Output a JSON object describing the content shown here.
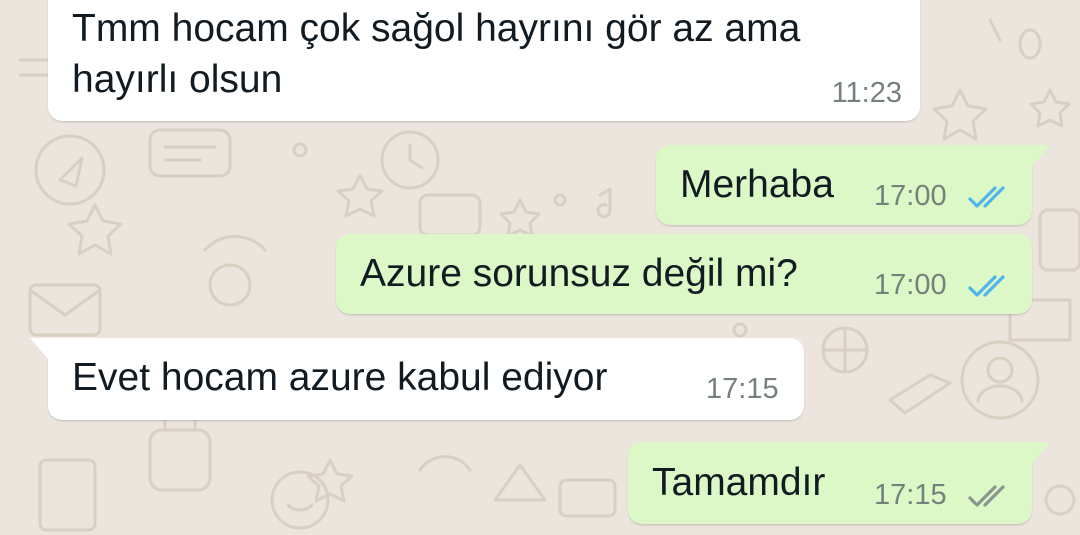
{
  "chat": {
    "messages": [
      {
        "direction": "incoming",
        "lines": [
          "Tmm hocam çok sağol hayrını gör az ama",
          "hayırlı olsun"
        ],
        "time": "11:23"
      },
      {
        "direction": "outgoing",
        "text": "Merhaba",
        "time": "17:00",
        "status": "read",
        "status_icon": "double-check-icon",
        "status_color": "#4fb6ec"
      },
      {
        "direction": "outgoing",
        "text": "Azure sorunsuz değil mi?",
        "time": "17:00",
        "status": "read",
        "status_icon": "double-check-icon",
        "status_color": "#4fb6ec"
      },
      {
        "direction": "incoming",
        "text": "Evet hocam azure kabul ediyor",
        "time": "17:15"
      },
      {
        "direction": "outgoing",
        "text": "Tamamdır",
        "time": "17:15",
        "status": "delivered",
        "status_icon": "double-check-icon",
        "status_color": "#8a9590"
      }
    ]
  },
  "theme": {
    "wallpaper_color": "#ece5dd",
    "incoming_bubble_color": "#ffffff",
    "outgoing_bubble_color": "#dcf8c6"
  }
}
